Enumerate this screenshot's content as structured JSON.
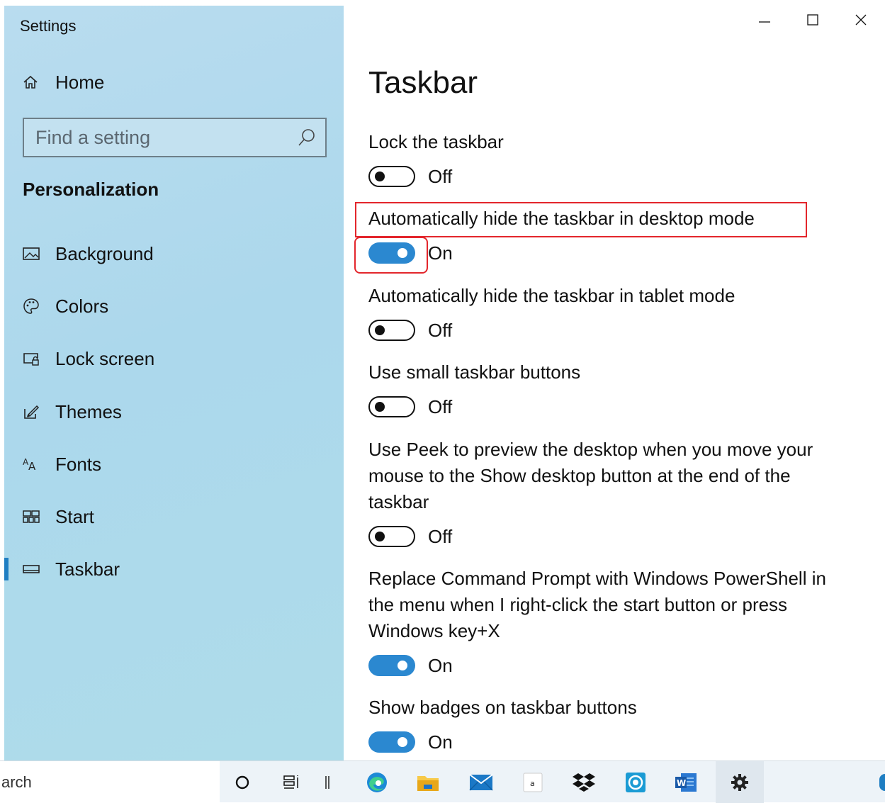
{
  "window": {
    "app_title": "Settings"
  },
  "sidebar": {
    "home": {
      "label": "Home",
      "icon": "home-icon"
    },
    "search": {
      "placeholder": "Find a setting",
      "icon": "search-icon"
    },
    "section_title": "Personalization",
    "items": [
      {
        "label": "Background",
        "icon": "picture-icon",
        "selected": false
      },
      {
        "label": "Colors",
        "icon": "palette-icon",
        "selected": false
      },
      {
        "label": "Lock screen",
        "icon": "lock-screen-icon",
        "selected": false
      },
      {
        "label": "Themes",
        "icon": "themes-brush-icon",
        "selected": false
      },
      {
        "label": "Fonts",
        "icon": "fonts-icon",
        "selected": false
      },
      {
        "label": "Start",
        "icon": "start-tiles-icon",
        "selected": false
      },
      {
        "label": "Taskbar",
        "icon": "taskbar-icon",
        "selected": true
      }
    ],
    "accent_color": "#1f7ec2"
  },
  "main": {
    "title": "Taskbar",
    "settings": [
      {
        "label": "Lock the taskbar",
        "state": "Off",
        "on": false
      },
      {
        "label": "Automatically hide the taskbar in desktop mode",
        "state": "On",
        "on": true
      },
      {
        "label": "Automatically hide the taskbar in tablet mode",
        "state": "Off",
        "on": false
      },
      {
        "label": "Use small taskbar buttons",
        "state": "Off",
        "on": false
      },
      {
        "label": "Use Peek to preview the desktop when you move your mouse to the Show desktop button at the end of the taskbar",
        "state": "Off",
        "on": false
      },
      {
        "label": "Replace Command Prompt with Windows PowerShell in the menu when I right-click the start button or press Windows key+X",
        "state": "On",
        "on": true
      },
      {
        "label": "Show badges on taskbar buttons",
        "state": "On",
        "on": true
      }
    ],
    "toggle_on_color": "#2b88d0",
    "highlight_color": "#e3262c"
  },
  "taskbar": {
    "search_text": "arch",
    "icons": [
      "cortana-icon",
      "task-view-icon",
      "edge-icon",
      "file-explorer-icon",
      "mail-icon",
      "amazon-icon",
      "dropbox-icon",
      "app-icon",
      "word-icon",
      "settings-gear-icon"
    ]
  }
}
